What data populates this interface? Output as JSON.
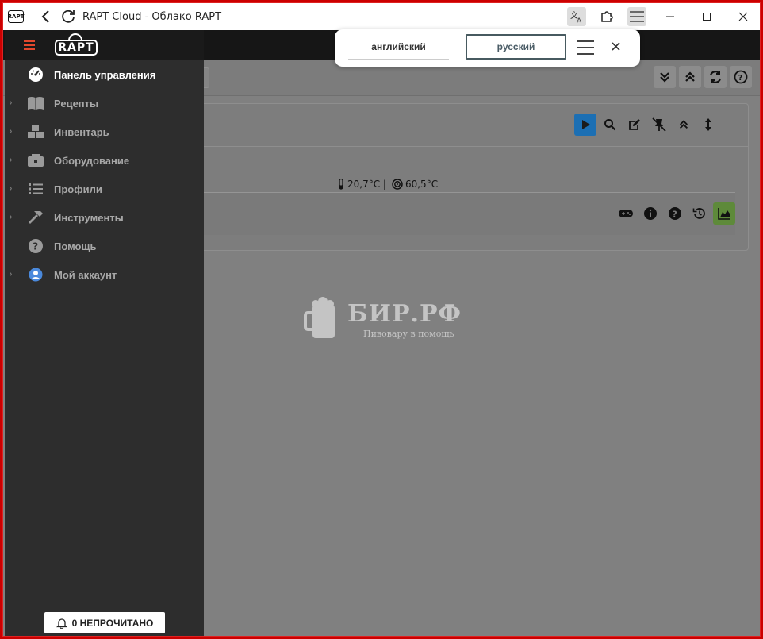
{
  "window": {
    "favicon_text": "RAPT",
    "title": "RAPT Cloud - Облако RAPT"
  },
  "sidebar": {
    "logo_text": "RAPT",
    "items": [
      {
        "label": "Панель управления",
        "icon": "dashboard-icon",
        "active": true,
        "expandable": false
      },
      {
        "label": "Рецепты",
        "icon": "book-icon",
        "active": false,
        "expandable": true
      },
      {
        "label": "Инвентарь",
        "icon": "boxes-icon",
        "active": false,
        "expandable": true
      },
      {
        "label": "Оборудование",
        "icon": "toolbox-icon",
        "active": false,
        "expandable": true
      },
      {
        "label": "Профили",
        "icon": "list-icon",
        "active": false,
        "expandable": true
      },
      {
        "label": "Инструменты",
        "icon": "hammer-icon",
        "active": false,
        "expandable": true
      },
      {
        "label": "Помощь",
        "icon": "question-icon",
        "active": false,
        "expandable": false
      },
      {
        "label": "Мой аккаунт",
        "icon": "user-circle-icon",
        "active": false,
        "expandable": true
      }
    ],
    "notifications_label": "0 НЕПРОЧИТАНО"
  },
  "device_card": {
    "temperature": "20,7°C |",
    "target_temperature": "60,5°C"
  },
  "watermark": {
    "title": "БИР.РФ",
    "subtitle": "Пивовару в помощь"
  },
  "translate_popup": {
    "source_language": "английский",
    "target_language": "русский"
  },
  "colors": {
    "accent_red": "#e2482d",
    "play_blue": "#1c6fb3",
    "chart_green": "#5e8a3a",
    "sidebar_bg": "#2d2d2d",
    "overlay_gray": "#808080"
  }
}
